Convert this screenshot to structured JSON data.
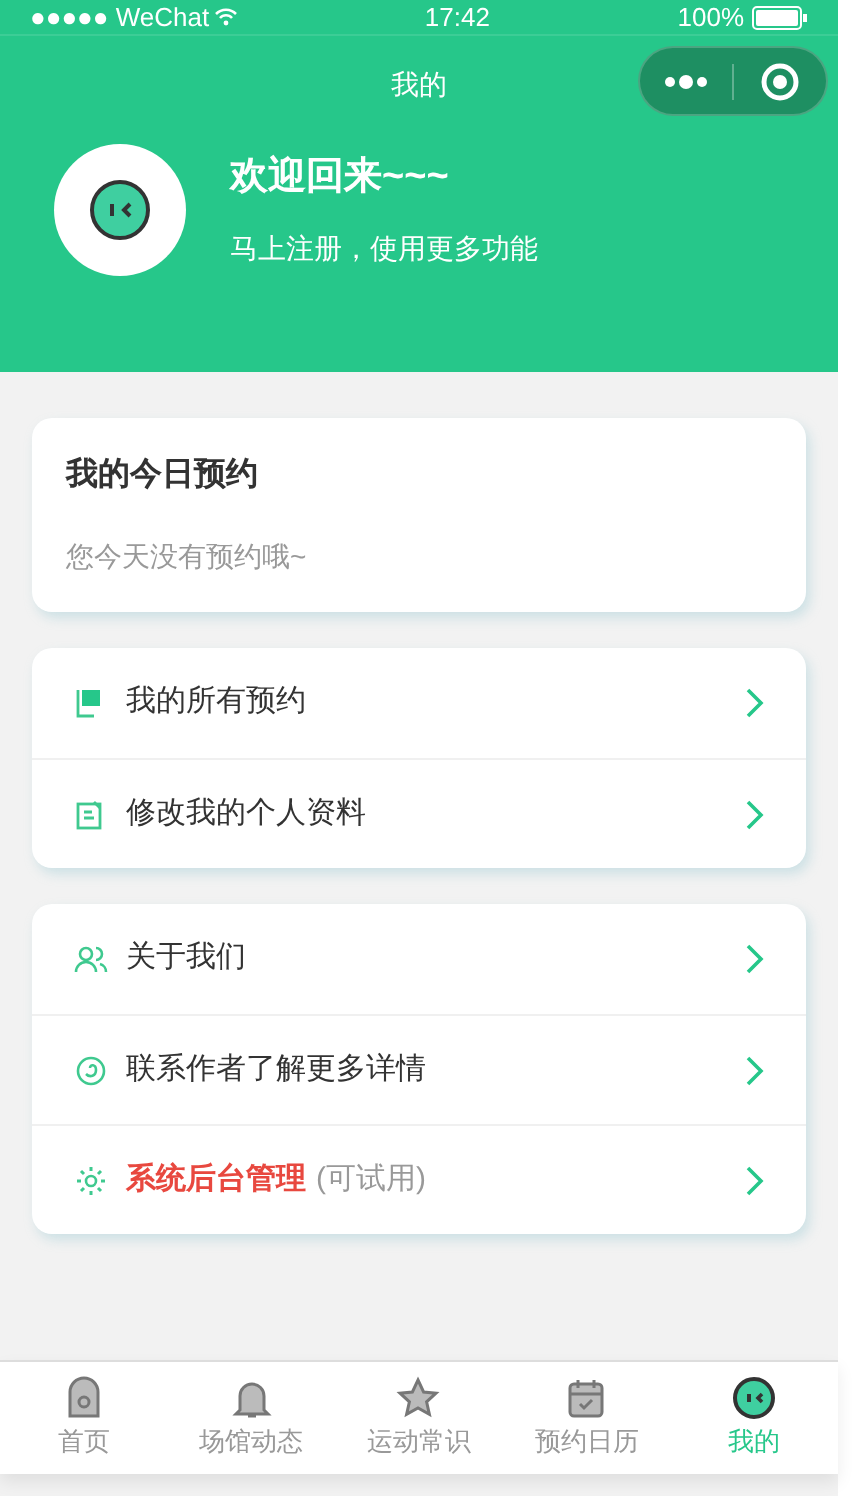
{
  "status_bar": {
    "carrier": "●●●●● WeChat",
    "time": "17:42",
    "battery": "100%"
  },
  "nav": {
    "title": "我的"
  },
  "profile": {
    "greeting": "欢迎回来~~~",
    "subtitle": "马上注册，使用更多功能"
  },
  "today": {
    "title": "我的今日预约",
    "empty_text": "您今天没有预约哦~"
  },
  "menu_groups": [
    {
      "items": [
        {
          "label": "我的所有预约",
          "kind": "normal"
        },
        {
          "label": "修改我的个人资料",
          "kind": "normal"
        }
      ]
    },
    {
      "items": [
        {
          "label": "关于我们",
          "kind": "normal"
        },
        {
          "label": "联系作者了解更多详情",
          "kind": "normal"
        },
        {
          "label": "系统后台管理",
          "note": "(可试用)",
          "kind": "highlight"
        }
      ]
    }
  ],
  "tab_bar": [
    {
      "label": "首页",
      "selected": false
    },
    {
      "label": "场馆动态",
      "selected": false
    },
    {
      "label": "运动常识",
      "selected": false
    },
    {
      "label": "预约日历",
      "selected": false
    },
    {
      "label": "我的",
      "selected": true
    }
  ]
}
